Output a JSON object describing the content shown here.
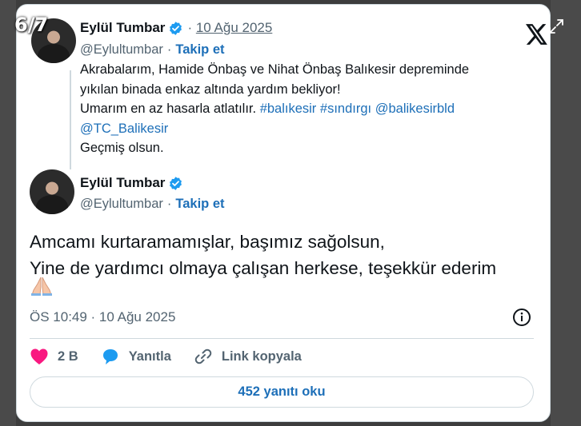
{
  "carousel": {
    "counter": "6/7"
  },
  "colors": {
    "accent": "#1d6fb8",
    "like": "#f91880",
    "reply": "#1d9bf0",
    "text": "#0f1419",
    "muted": "#536471",
    "border": "#cfd9de"
  },
  "icons": {
    "logo": "x-logo-icon",
    "expand": "expand-icon",
    "verified": "verified-badge-icon",
    "info": "info-icon",
    "like": "heart-icon",
    "reply": "speech-bubble-icon",
    "link": "link-icon",
    "emoji": "folded-hands-emoji"
  },
  "tweet1": {
    "author_name": "Eylül Tumbar",
    "date": "10 Ağu 2025",
    "handle": "@Eylultumbar",
    "follow_label": "Takip et",
    "text_line1": "Akrabalarım, Hamide Önbaş ve Nihat Önbaş Balıkesir depreminde",
    "text_line2": "yıkılan binada enkaz altında yardım bekliyor!",
    "text_line3_prefix": "Umarım en az hasarla atlatılır.",
    "hashtags": [
      "#balıkesir",
      "#sındırgı"
    ],
    "mentions": [
      "@balikesirbld",
      "@TC_Balikesir"
    ],
    "text_line5": "Geçmiş olsun."
  },
  "tweet2": {
    "author_name": "Eylül Tumbar",
    "handle": "@Eylultumbar",
    "follow_label": "Takip et",
    "text_line1": "Amcamı kurtaramamışlar, başımız sağolsun,",
    "text_line2": "Yine de yardımcı olmaya çalışan herkese, teşekkür ederim",
    "timestamp": "ÖS 10:49 · 10 Ağu 2025"
  },
  "actions": {
    "like_count": "2 B",
    "reply_label": "Yanıtla",
    "copy_link_label": "Link kopyala"
  },
  "read_replies_label": "452 yanıtı oku"
}
